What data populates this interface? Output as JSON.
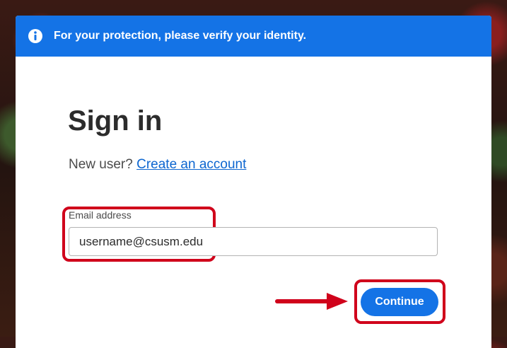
{
  "banner": {
    "icon": "info-icon",
    "message": "For your protection, please verify your identity.",
    "color": "#1473e6"
  },
  "signin": {
    "title": "Sign in",
    "new_user_prefix": "New user?",
    "create_account_link": "Create an account"
  },
  "email": {
    "label": "Email address",
    "value": "username@csusm.edu"
  },
  "continue_label": "Continue",
  "colors": {
    "accent": "#1473e6",
    "annotation": "#d0021b",
    "link": "#0d66d0"
  }
}
